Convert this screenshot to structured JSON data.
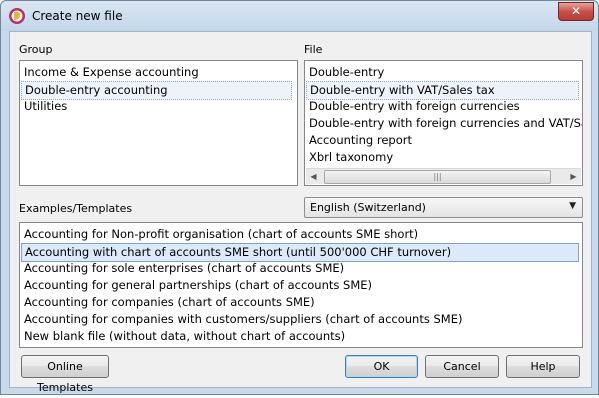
{
  "window": {
    "title": "Create new file"
  },
  "group": {
    "label": "Group",
    "items": [
      {
        "label": "Income & Expense accounting",
        "state": "normal"
      },
      {
        "label": "Double-entry accounting",
        "state": "selected"
      },
      {
        "label": "Utilities",
        "state": "normal"
      }
    ]
  },
  "file": {
    "label": "File",
    "items": [
      {
        "label": "Double-entry",
        "state": "normal"
      },
      {
        "label": "Double-entry with VAT/Sales tax",
        "state": "selected"
      },
      {
        "label": "Double-entry with foreign currencies",
        "state": "normal"
      },
      {
        "label": "Double-entry with foreign currencies and VAT/Sales tax",
        "state": "normal"
      },
      {
        "label": "Accounting report",
        "state": "normal"
      },
      {
        "label": "Xbrl taxonomy",
        "state": "normal"
      }
    ]
  },
  "templates": {
    "label": "Examples/Templates",
    "language": "English (Switzerland)",
    "items": [
      {
        "label": "Accounting for Non-profit organisation (chart of accounts SME short)",
        "state": "normal"
      },
      {
        "label": "Accounting with chart of accounts SME short (until 500'000 CHF turnover)",
        "state": "highlighted"
      },
      {
        "label": "Accounting for sole enterprises (chart of accounts SME)",
        "state": "normal"
      },
      {
        "label": "Accounting for general partnerships (chart of accounts SME)",
        "state": "normal"
      },
      {
        "label": "Accounting for companies (chart of accounts SME)",
        "state": "normal"
      },
      {
        "label": "Accounting for companies with customers/suppliers (chart of accounts SME)",
        "state": "normal"
      },
      {
        "label": "New blank file (without data, without chart of accounts)",
        "state": "normal"
      }
    ]
  },
  "buttons": {
    "online_templates": "Online Templates",
    "ok": "OK",
    "cancel": "Cancel",
    "help": "Help"
  },
  "icons": {
    "app": "banana-app-icon",
    "close": "close-icon",
    "scroll_left": "scroll-left-arrow-icon",
    "scroll_right": "scroll-right-arrow-icon",
    "dropdown": "chevron-down-icon"
  },
  "colors": {
    "title_bar": "#c2d6ea",
    "close_button": "#c75050",
    "selection": "#dbe9f8"
  }
}
